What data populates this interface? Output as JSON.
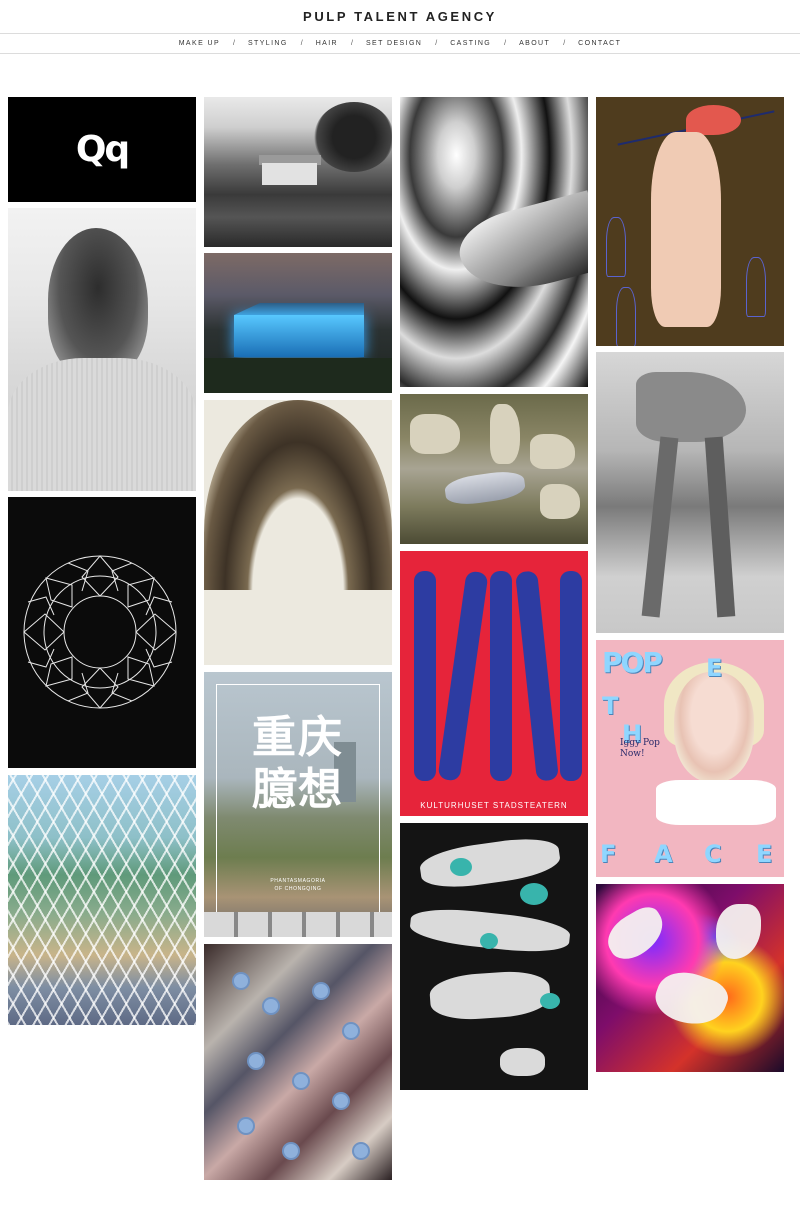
{
  "site": {
    "brand": "PULP TALENT AGENCY"
  },
  "nav": {
    "items": [
      "MAKE UP",
      "STYLING",
      "HAIR",
      "SET DESIGN",
      "CASTING",
      "ABOUT",
      "CONTACT"
    ],
    "separator": "/"
  },
  "gallery": {
    "logo_text": "Qq",
    "chongqing": {
      "title_line1": "重庆",
      "title_line2": "臆想",
      "subtitle_line1": "PHANTASMAGORIA",
      "subtitle_line2": "OF CHONGQING"
    },
    "poster": {
      "footer": "KULTURHUSET STADSTEATERN"
    },
    "face": {
      "logo": "POP",
      "letters_top": [
        "T",
        "H",
        "E"
      ],
      "letters_bottom": [
        "F",
        "A",
        "C",
        "E"
      ],
      "cover_text_line1": "Iggy Pop",
      "cover_text_line2": "Now!"
    }
  },
  "colors": {
    "nav_border": "#dcdcdc",
    "text": "#222222",
    "poster_red": "#e6243a",
    "poster_blue": "#2d3ca2",
    "hero_brown": "#4f3c1e",
    "face_pink": "#f2b6c1"
  }
}
